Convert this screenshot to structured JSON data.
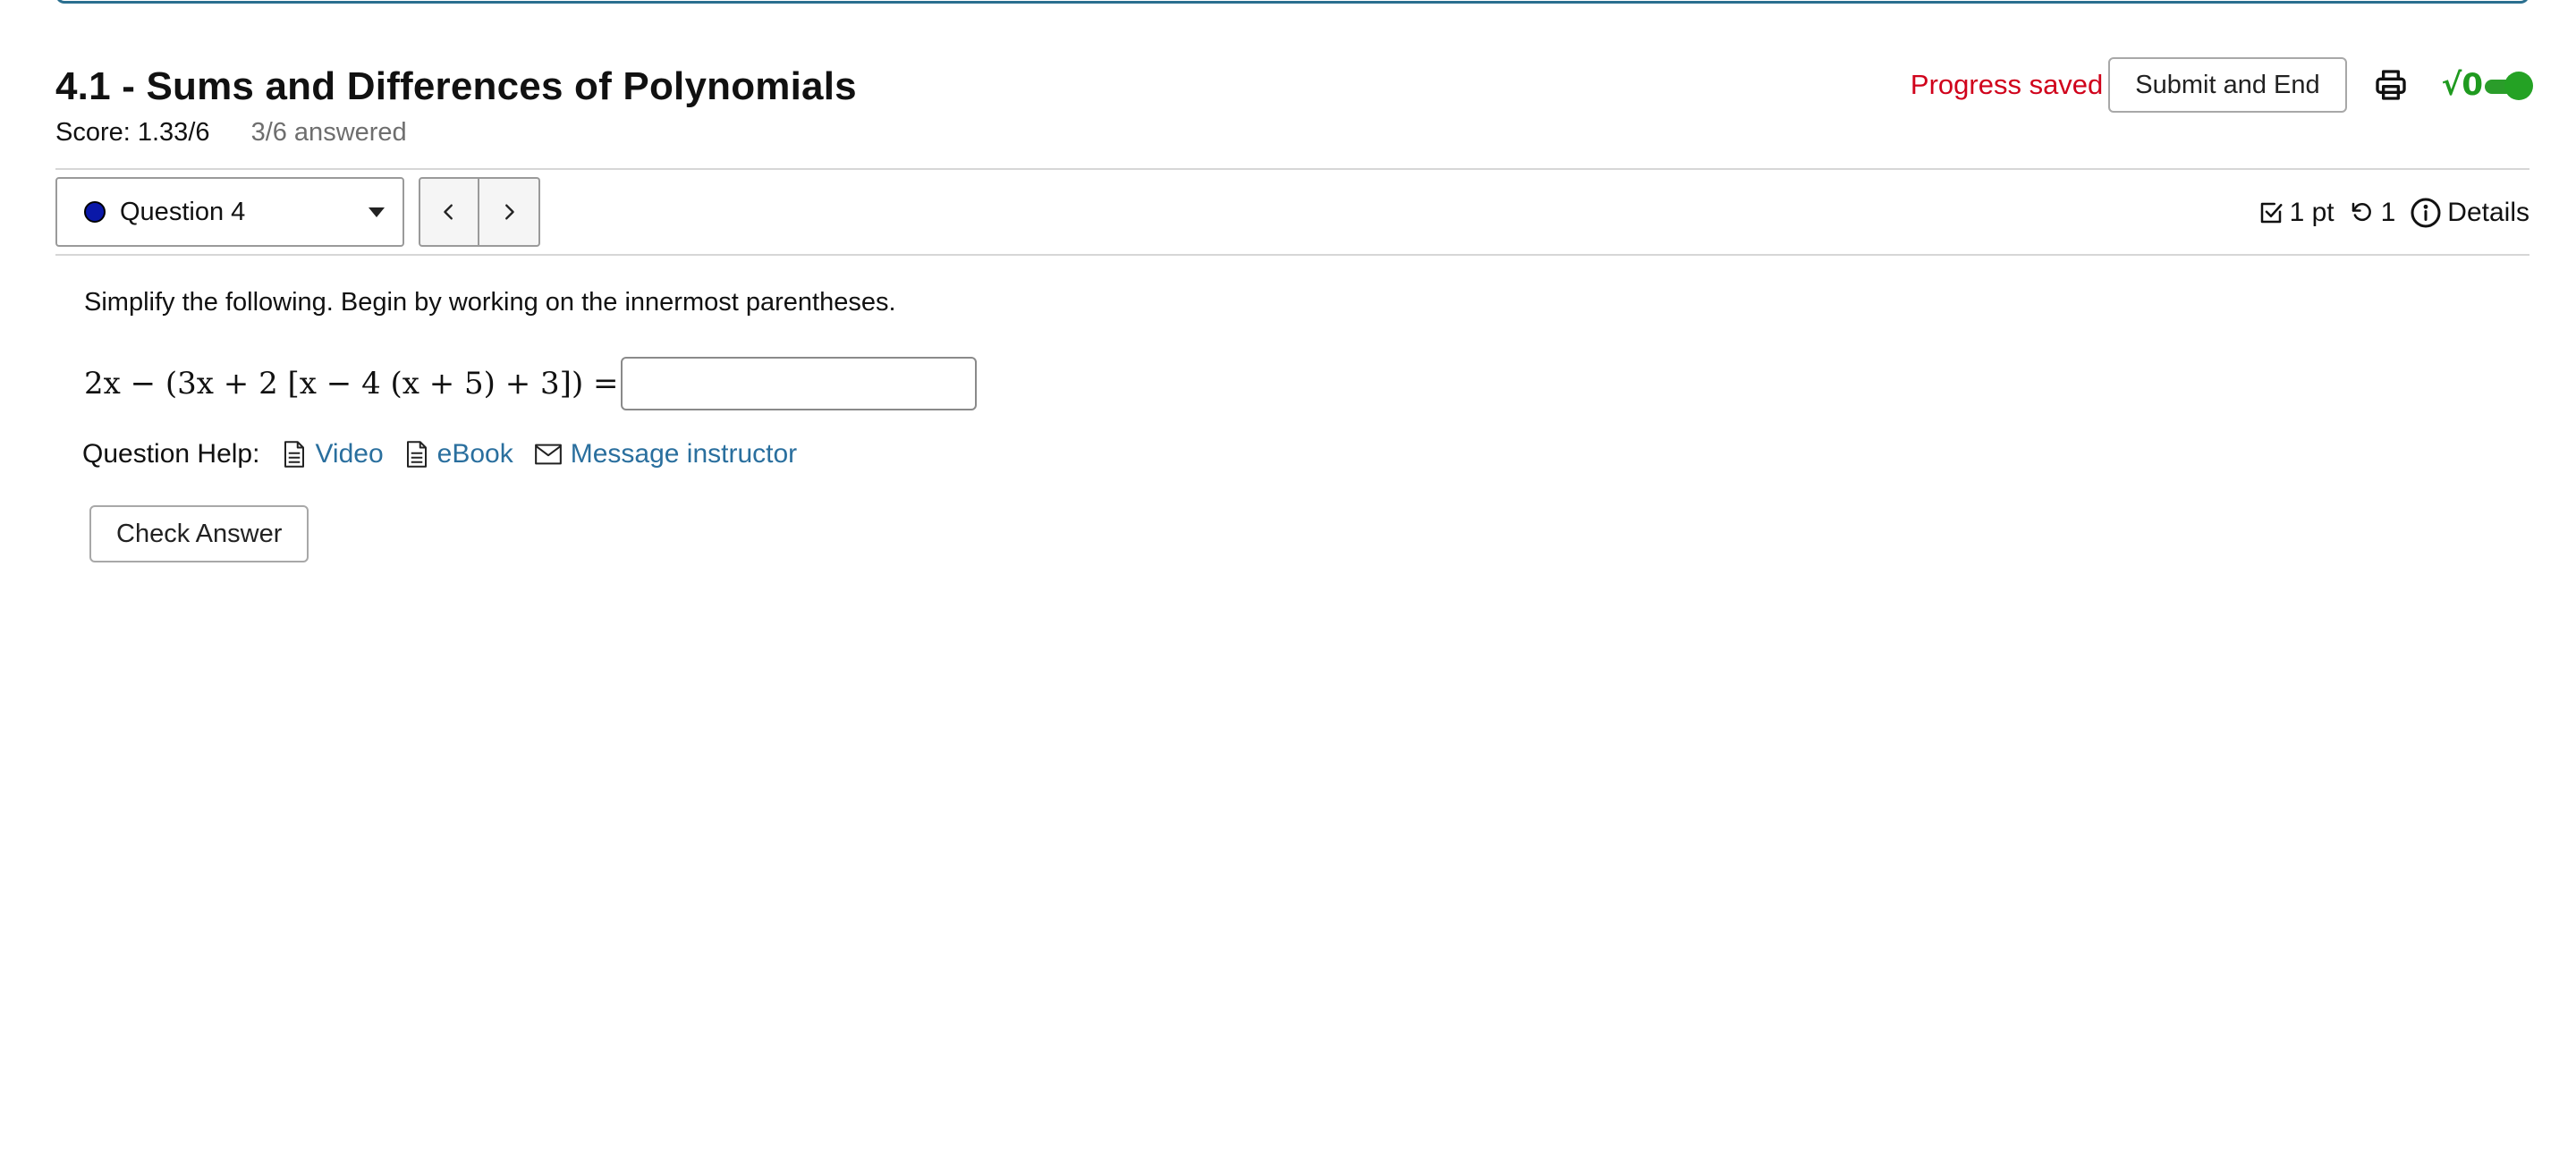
{
  "assignment": {
    "title": "4.1 - Sums and Differences of Polynomials",
    "score": "Score: 1.33/6",
    "answered": "3/6 answered"
  },
  "header": {
    "progress_status": "Progress saved",
    "submit_label": "Submit and End",
    "print_icon": "printer-icon",
    "math_toggle_glyph": "√0",
    "math_toggle_on": true,
    "accent_color": "#2a6f8f",
    "status_color": "#d0021b",
    "toggle_color": "#24a224"
  },
  "question_nav": {
    "selected": "Question 4",
    "status_color": "#0a18a8",
    "prev_icon": "chevron-left-icon",
    "next_icon": "chevron-right-icon"
  },
  "question_meta": {
    "points": "1 pt",
    "attempts": "1",
    "details_label": "Details"
  },
  "question": {
    "prompt": "Simplify the following. Begin by working on the innermost parentheses.",
    "expression": "2x − (3x + 2 [x − 4 (x + 5) + 3]) =",
    "answer_value": ""
  },
  "help": {
    "label": "Question Help:",
    "links": [
      {
        "label": "Video",
        "icon": "document-icon"
      },
      {
        "label": "eBook",
        "icon": "document-icon"
      },
      {
        "label": "Message instructor",
        "icon": "envelope-icon"
      }
    ],
    "link_color": "#2a6f9e"
  },
  "actions": {
    "check_label": "Check Answer"
  }
}
